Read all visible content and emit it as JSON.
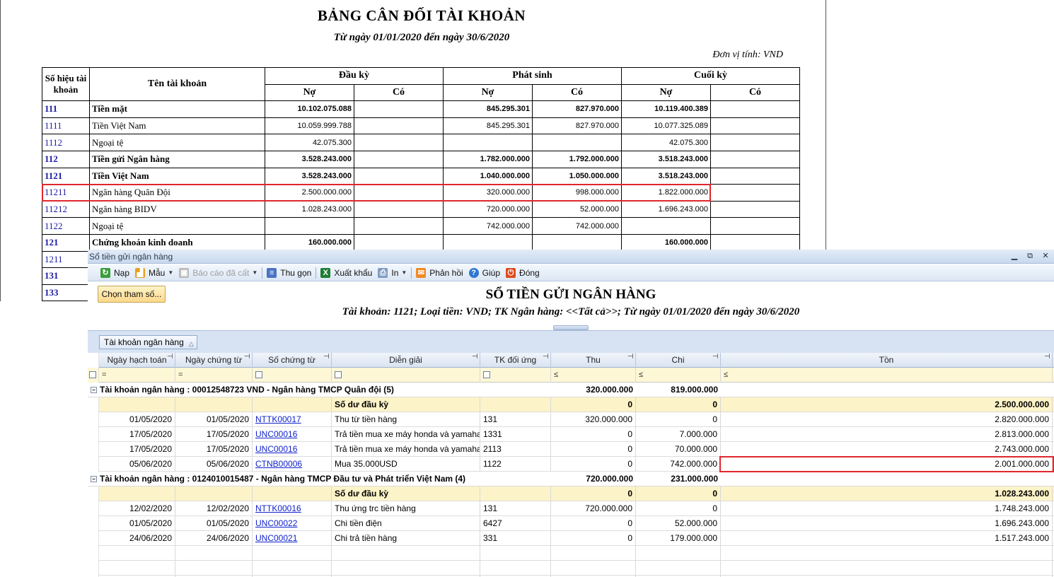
{
  "report": {
    "title": "BẢNG CÂN ĐỐI TÀI KHOẢN",
    "subtitle": "Từ ngày 01/01/2020 đến ngày 30/6/2020",
    "unit": "Đơn vị tính: VND",
    "headers": {
      "code": "Số hiệu tài khoản",
      "name": "Tên tài khoản",
      "opening": "Đầu kỳ",
      "movement": "Phát sinh",
      "closing": "Cuối kỳ",
      "debit": "Nợ",
      "credit": "Có"
    },
    "rows": [
      {
        "code": "111",
        "name": "Tiền mặt",
        "od": "10.102.075.088",
        "oc": "",
        "md": "845.295.301",
        "mc": "827.970.000",
        "cd": "10.119.400.389",
        "cc": "",
        "bold": true
      },
      {
        "code": "1111",
        "name": "Tiền Việt Nam",
        "od": "10.059.999.788",
        "oc": "",
        "md": "845.295.301",
        "mc": "827.970.000",
        "cd": "10.077.325.089",
        "cc": "",
        "bold": false
      },
      {
        "code": "1112",
        "name": "Ngoại tệ",
        "od": "42.075.300",
        "oc": "",
        "md": "",
        "mc": "",
        "cd": "42.075.300",
        "cc": "",
        "bold": false
      },
      {
        "code": "112",
        "name": "Tiền gửi Ngân hàng",
        "od": "3.528.243.000",
        "oc": "",
        "md": "1.782.000.000",
        "mc": "1.792.000.000",
        "cd": "3.518.243.000",
        "cc": "",
        "bold": true
      },
      {
        "code": "1121",
        "name": "Tiền Việt Nam",
        "od": "3.528.243.000",
        "oc": "",
        "md": "1.040.000.000",
        "mc": "1.050.000.000",
        "cd": "3.518.243.000",
        "cc": "",
        "bold": true
      },
      {
        "code": "11211",
        "name": "Ngân hàng Quân Đội",
        "od": "2.500.000.000",
        "oc": "",
        "md": "320.000.000",
        "mc": "998.000.000",
        "cd": "1.822.000.000",
        "cc": "",
        "bold": false
      },
      {
        "code": "11212",
        "name": "Ngân hàng BIDV",
        "od": "1.028.243.000",
        "oc": "",
        "md": "720.000.000",
        "mc": "52.000.000",
        "cd": "1.696.243.000",
        "cc": "",
        "bold": false
      },
      {
        "code": "1122",
        "name": "Ngoại tệ",
        "od": "",
        "oc": "",
        "md": "742.000.000",
        "mc": "742.000.000",
        "cd": "",
        "cc": "",
        "bold": false
      },
      {
        "code": "121",
        "name": "Chứng khoán kinh doanh",
        "od": "160.000.000",
        "oc": "",
        "md": "",
        "mc": "",
        "cd": "160.000.000",
        "cc": "",
        "bold": true
      },
      {
        "code": "1211",
        "name": "",
        "od": "",
        "oc": "",
        "md": "",
        "mc": "",
        "cd": "",
        "cc": "",
        "bold": false
      },
      {
        "code": "131",
        "name": "",
        "od": "",
        "oc": "",
        "md": "",
        "mc": "",
        "cd": "",
        "cc": "",
        "bold": true
      },
      {
        "code": "133",
        "name": "",
        "od": "",
        "oc": "",
        "md": "",
        "mc": "",
        "cd": "",
        "cc": "",
        "bold": true
      }
    ]
  },
  "window": {
    "title": "Sổ tiền gửi ngân hàng",
    "controls": [
      "▁",
      "⧉",
      "✕"
    ],
    "toolbar": {
      "reload": "Nạp",
      "template": "Mẫu",
      "saved_report": "Báo cáo đã cất",
      "collapse": "Thu gọn",
      "export": "Xuất khẩu",
      "print": "In",
      "feedback": "Phản hồi",
      "help": "Giúp",
      "close": "Đóng"
    },
    "param_button": "Chọn tham số...",
    "report_title": "SỔ TIỀN GỬI NGÂN HÀNG",
    "report_subtitle": "Tài khoản: 1121; Loại tiền: VND; TK Ngân hàng: <<Tất cả>>; Từ ngày 01/01/2020 đến ngày 30/6/2020",
    "group_chip": "Tài khoản ngân hàng",
    "columns": [
      "Ngày hạch toán",
      "Ngày chứng từ",
      "Số chứng từ",
      "Diễn giải",
      "TK đối ứng",
      "Thu",
      "Chi",
      "Tồn"
    ],
    "filter_ops": [
      "=",
      "=",
      "",
      "",
      "",
      "≤",
      "≤",
      "≤"
    ],
    "groups": [
      {
        "title": "Tài khoản ngân hàng : 00012548723 VND - Ngân hàng TMCP Quân đội (5)",
        "thu": "320.000.000",
        "chi": "819.000.000",
        "opening_label": "Số dư đầu kỳ",
        "opening_thu": "0",
        "opening_chi": "0",
        "opening_ton": "2.500.000.000",
        "rows": [
          {
            "d1": "01/05/2020",
            "d2": "01/05/2020",
            "doc": "NTTK00017",
            "desc": "Thu từ tiền hàng",
            "acc": "131",
            "thu": "320.000.000",
            "chi": "0",
            "ton": "2.820.000.000"
          },
          {
            "d1": "17/05/2020",
            "d2": "17/05/2020",
            "doc": "UNC00016",
            "desc": "Trả tiền mua xe máy honda và yamaha",
            "acc": "1331",
            "thu": "0",
            "chi": "7.000.000",
            "ton": "2.813.000.000"
          },
          {
            "d1": "17/05/2020",
            "d2": "17/05/2020",
            "doc": "UNC00016",
            "desc": "Trả tiền mua xe máy honda và yamaha",
            "acc": "2113",
            "thu": "0",
            "chi": "70.000.000",
            "ton": "2.743.000.000"
          },
          {
            "d1": "05/06/2020",
            "d2": "05/06/2020",
            "doc": "CTNB00006",
            "desc": "Mua 35.000USD",
            "acc": "1122",
            "thu": "0",
            "chi": "742.000.000",
            "ton": "2.001.000.000"
          }
        ]
      },
      {
        "title": "Tài khoản ngân hàng : 0124010015487 - Ngân hàng TMCP Đầu tư và Phát triển Việt Nam (4)",
        "thu": "720.000.000",
        "chi": "231.000.000",
        "opening_label": "Số dư đầu kỳ",
        "opening_thu": "0",
        "opening_chi": "0",
        "opening_ton": "1.028.243.000",
        "rows": [
          {
            "d1": "12/02/2020",
            "d2": "12/02/2020",
            "doc": "NTTK00016",
            "desc": "Thu ứng trc tiền hàng",
            "acc": "131",
            "thu": "720.000.000",
            "chi": "0",
            "ton": "1.748.243.000"
          },
          {
            "d1": "01/05/2020",
            "d2": "01/05/2020",
            "doc": "UNC00022",
            "desc": "Chi tiền điện",
            "acc": "6427",
            "thu": "0",
            "chi": "52.000.000",
            "ton": "1.696.243.000"
          },
          {
            "d1": "24/06/2020",
            "d2": "24/06/2020",
            "doc": "UNC00021",
            "desc": "Chi trả tiền hàng",
            "acc": "331",
            "thu": "0",
            "chi": "179.000.000",
            "ton": "1.517.243.000"
          }
        ]
      }
    ]
  },
  "colors": {
    "highlight": "#e0262e",
    "link": "#1122cc",
    "account_code": "#1a1aa6"
  }
}
